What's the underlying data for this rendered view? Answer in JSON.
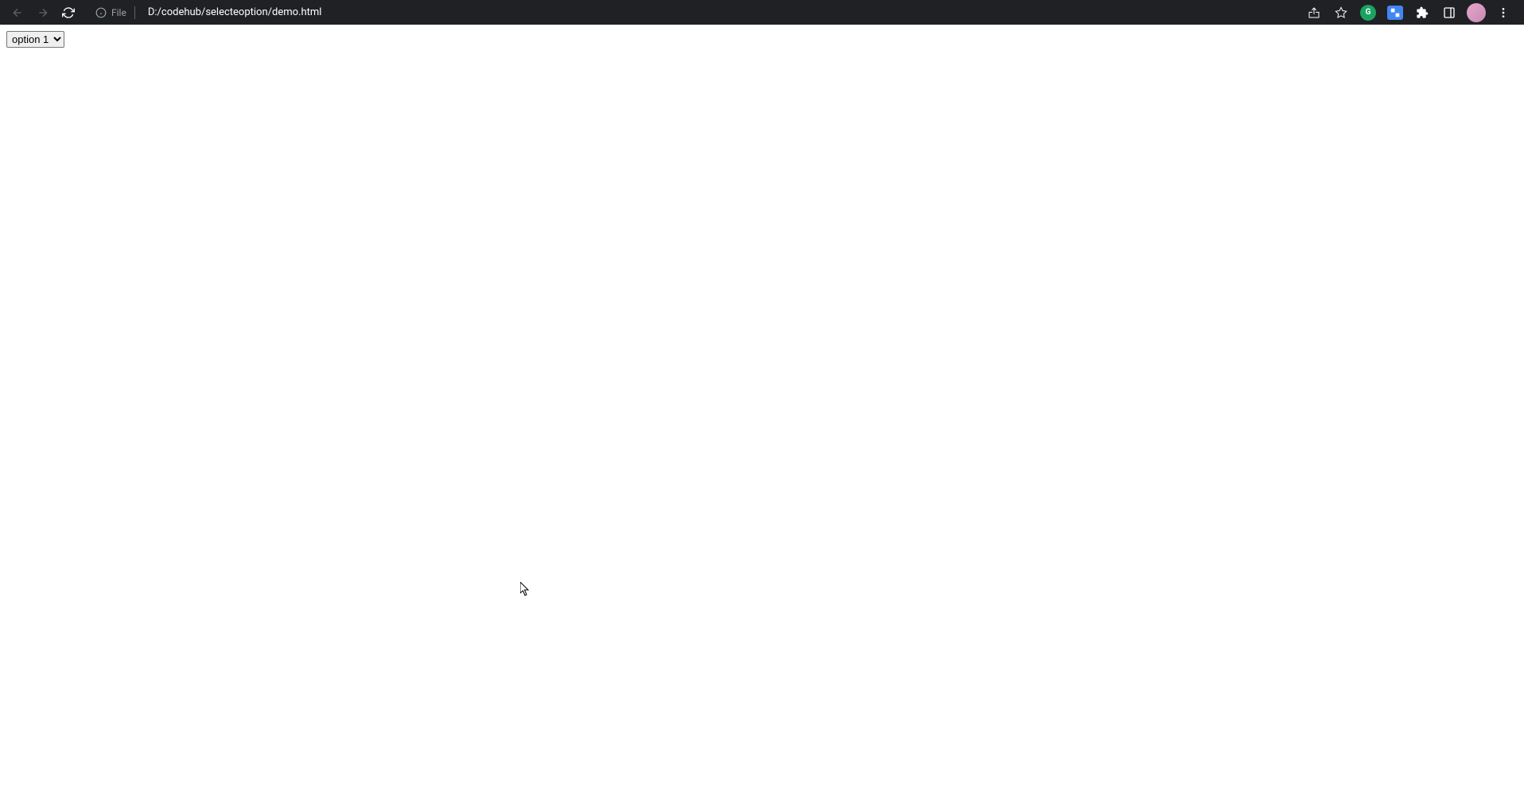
{
  "browser": {
    "url_scheme": "File",
    "url_path": "D:/codehub/selecteoption/demo.html"
  },
  "page": {
    "select": {
      "selected": "option 1"
    }
  }
}
